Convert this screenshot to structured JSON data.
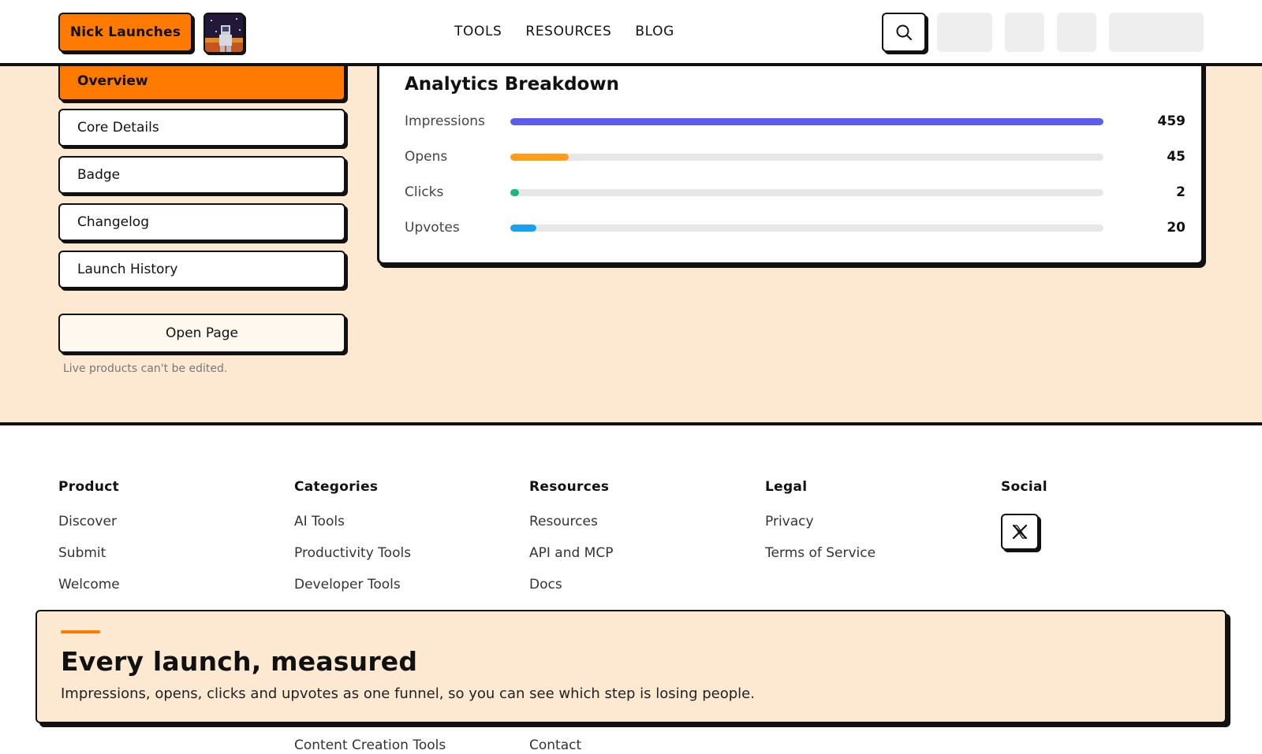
{
  "header": {
    "brand": "Nick Launches",
    "nav": [
      "TOOLS",
      "RESOURCES",
      "BLOG"
    ]
  },
  "sidebar": {
    "items": [
      {
        "label": "Overview",
        "active": true
      },
      {
        "label": "Core Details",
        "active": false
      },
      {
        "label": "Badge",
        "active": false
      },
      {
        "label": "Changelog",
        "active": false
      },
      {
        "label": "Launch History",
        "active": false
      }
    ],
    "open_page": "Open Page",
    "note": "Live products can't be edited."
  },
  "analytics": {
    "title": "Analytics Breakdown",
    "max": 459,
    "metrics": [
      {
        "label": "Impressions",
        "value": 459,
        "color": "#5b5cf0"
      },
      {
        "label": "Opens",
        "value": 45,
        "color": "#ff9c1a"
      },
      {
        "label": "Clicks",
        "value": 2,
        "color": "#18b981"
      },
      {
        "label": "Upvotes",
        "value": 20,
        "color": "#1aa0f0"
      }
    ]
  },
  "footer": {
    "columns": [
      {
        "title": "Product",
        "links": [
          "Discover",
          "Submit",
          "Welcome"
        ]
      },
      {
        "title": "Categories",
        "links": [
          "AI Tools",
          "Productivity Tools",
          "Developer Tools"
        ]
      },
      {
        "title": "Resources",
        "links": [
          "Resources",
          "API and MCP",
          "Docs"
        ]
      },
      {
        "title": "Legal",
        "links": [
          "Privacy",
          "Terms of Service"
        ]
      },
      {
        "title": "Social",
        "links": []
      }
    ],
    "extra_links": [
      "Content Creation Tools",
      "Contact"
    ]
  },
  "promo": {
    "title": "Every launch, measured",
    "text": "Impressions, opens, clicks and upvotes as one funnel, so you can see which step is losing people."
  },
  "colors": {
    "accent": "#ff7a00",
    "cream": "#fde9d2"
  }
}
